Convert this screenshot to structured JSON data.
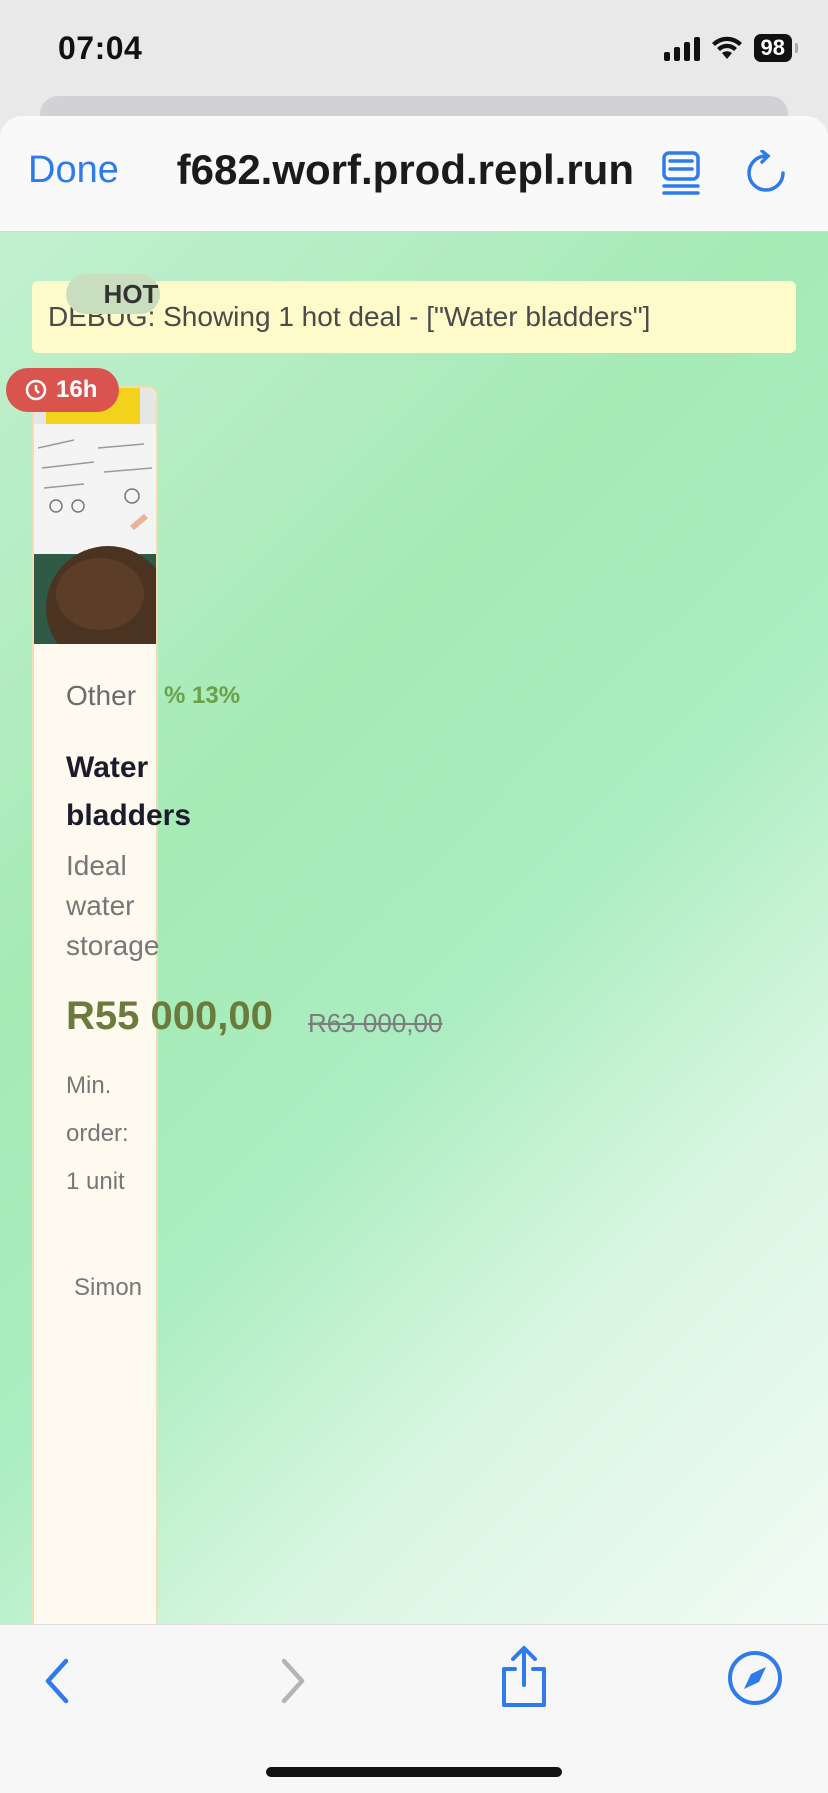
{
  "status_bar": {
    "time": "07:04",
    "battery": "98",
    "icons": [
      "cellular-signal-icon",
      "wifi-icon",
      "battery-icon"
    ]
  },
  "browser": {
    "done_label": "Done",
    "url": "f682.worf.prod.repl.run",
    "icons": [
      "reader-mode-icon",
      "reload-icon"
    ],
    "accent_color": "#2f7be9"
  },
  "debug": {
    "text": "DEBUG: Showing 1 hot deal - [\"Water bladders\"]"
  },
  "deal": {
    "hot_label": "HOT",
    "timer": "16h",
    "category": "Other",
    "discount": "% 13%",
    "title": "Water bladders",
    "description": "Ideal water storage",
    "price": "R55 000,00",
    "old_price": "R63 000,00",
    "min_order": "Min. order: 1 unit",
    "seller": "Simon",
    "timer_color": "#d9534f",
    "price_color": "#6b7b3b"
  },
  "toolbar": {
    "icons": [
      "back-arrow-icon",
      "forward-arrow-icon",
      "share-icon",
      "safari-compass-icon"
    ]
  }
}
